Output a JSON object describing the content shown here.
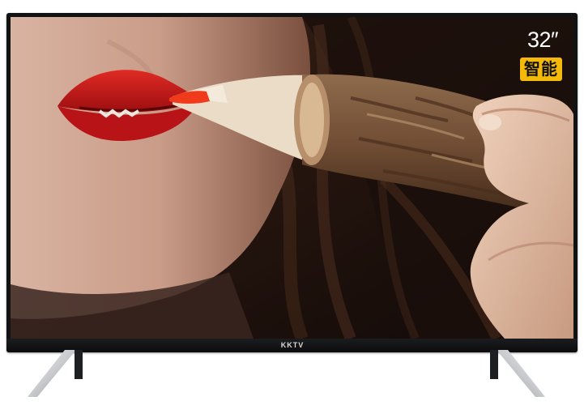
{
  "product": {
    "brand_logo": "KKTV",
    "size_label": "32″",
    "smart_label": "智能"
  },
  "icons": {
    "tv": "tv-set-icon",
    "stand": "tv-stand-leg-icon"
  },
  "colors": {
    "bezel": "#111214",
    "smart_badge_bg": "#f5b90a",
    "badge_text": "#ffffff"
  }
}
